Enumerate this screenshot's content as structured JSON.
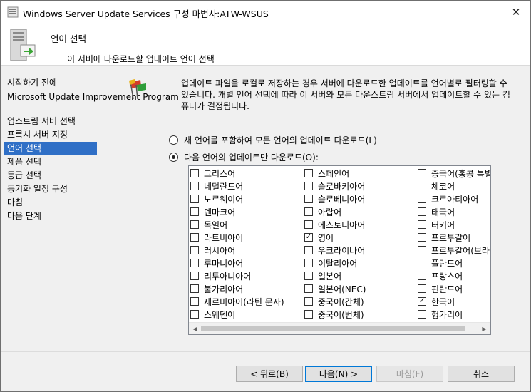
{
  "window": {
    "title": "Windows Server Update Services 구성 마법사:ATW-WSUS",
    "close_glyph": "✕"
  },
  "header": {
    "title": "언어 선택",
    "subtitle": "이 서버에 다운로드할 업데이트 언어 선택"
  },
  "nav": {
    "items": [
      "시작하기 전에",
      "Microsoft Update Improvement Program",
      "업스트림 서버 선택",
      "프록시 서버 지정",
      "언어 선택",
      "제품 선택",
      "등급 선택",
      "동기화 일정 구성",
      "마침",
      "다음 단계"
    ],
    "active_index": 4
  },
  "content": {
    "description": "업데이트 파일을 로컬로 저장하는 경우 서버에 다운로드한 업데이트를 언어별로 필터링할 수 있습니다. 개별 언어 선택에 따라 이 서버와 모든 다운스트림 서버에서 업데이트할 수 있는 컴퓨터가 결정됩니다.",
    "radio_all": {
      "label": "새 언어를 포함하여 모든 언어의 업데이트 다운로드(L)",
      "checked": false
    },
    "radio_specific": {
      "label": "다음 언어의 업데이트만 다운로드(O):",
      "checked": true
    }
  },
  "languages": {
    "columns": [
      [
        {
          "label": "그리스어",
          "checked": false
        },
        {
          "label": "네덜란드어",
          "checked": false
        },
        {
          "label": "노르웨이어",
          "checked": false
        },
        {
          "label": "덴마크어",
          "checked": false
        },
        {
          "label": "독일어",
          "checked": false
        },
        {
          "label": "라트비아어",
          "checked": false
        },
        {
          "label": "러시아어",
          "checked": false
        },
        {
          "label": "루마니아어",
          "checked": false
        },
        {
          "label": "리투아니아어",
          "checked": false
        },
        {
          "label": "불가리아어",
          "checked": false
        },
        {
          "label": "세르비아어(라틴 문자)",
          "checked": false
        },
        {
          "label": "스웨덴어",
          "checked": false
        }
      ],
      [
        {
          "label": "스페인어",
          "checked": false
        },
        {
          "label": "슬로바키아어",
          "checked": false
        },
        {
          "label": "슬로베니아어",
          "checked": false
        },
        {
          "label": "아랍어",
          "checked": false
        },
        {
          "label": "에스토니아어",
          "checked": false
        },
        {
          "label": "영어",
          "checked": true
        },
        {
          "label": "우크라이나어",
          "checked": false
        },
        {
          "label": "이탈리아어",
          "checked": false
        },
        {
          "label": "일본어",
          "checked": false
        },
        {
          "label": "일본어(NEC)",
          "checked": false
        },
        {
          "label": "중국어(간체)",
          "checked": false
        },
        {
          "label": "중국어(번체)",
          "checked": false
        }
      ],
      [
        {
          "label": "중국어(홍콩 특별",
          "checked": false
        },
        {
          "label": "체코어",
          "checked": false
        },
        {
          "label": "크로아티아어",
          "checked": false
        },
        {
          "label": "태국어",
          "checked": false
        },
        {
          "label": "터키어",
          "checked": false
        },
        {
          "label": "포르투갈어",
          "checked": false
        },
        {
          "label": "포르투갈어(브라",
          "checked": false
        },
        {
          "label": "폴란드어",
          "checked": false
        },
        {
          "label": "프랑스어",
          "checked": false
        },
        {
          "label": "핀란드어",
          "checked": false
        },
        {
          "label": "한국어",
          "checked": true
        },
        {
          "label": "헝가리어",
          "checked": false
        }
      ]
    ]
  },
  "buttons": {
    "back": "< 뒤로(B)",
    "next": "다음(N) >",
    "finish": "마침(F)",
    "cancel": "취소"
  }
}
